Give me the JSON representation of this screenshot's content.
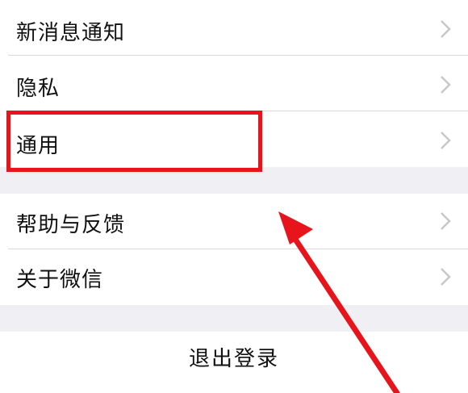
{
  "settings": {
    "items": [
      {
        "label": "新消息通知"
      },
      {
        "label": "隐私"
      },
      {
        "label": "通用"
      },
      {
        "label": "帮助与反馈"
      },
      {
        "label": "关于微信"
      }
    ],
    "logout_label": "退出登录"
  },
  "colors": {
    "background": "#efeff4",
    "row": "#ffffff",
    "highlight": "#e8141c",
    "chevron": "#c7c7cc"
  },
  "icons": {
    "chevron": "chevron-right-icon",
    "annotation_arrow": "arrow-up-left-icon"
  }
}
